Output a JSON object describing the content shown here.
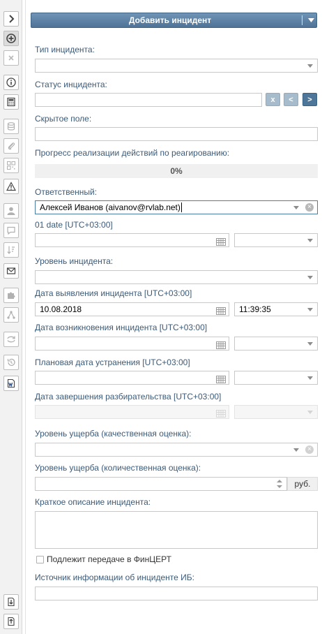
{
  "toolbar": {
    "icons": [
      "chevron-right-icon",
      "add-circle-icon",
      "close-icon",
      "info-icon",
      "calculator-icon",
      "database-icon",
      "paperclip-icon",
      "qr-code-icon",
      "warning-icon",
      "user-icon",
      "chat-icon",
      "sort-icon",
      "envelope-icon",
      "puzzle-icon",
      "network-icon",
      "sync-icon",
      "history-icon",
      "word-document-icon",
      "import-icon",
      "export-icon"
    ]
  },
  "form": {
    "add_button_label": "Добавить инцидент",
    "incident_type": {
      "label": "Тип инцидента:",
      "value": ""
    },
    "incident_status": {
      "label": "Статус инцидента:",
      "value": "",
      "btn_clear": "x",
      "btn_prev": "<",
      "btn_next": ">"
    },
    "hidden_field": {
      "label": "Скрытое поле:",
      "value": ""
    },
    "progress": {
      "label": "Прогресс реализации действий по реагированию:",
      "value_text": "0%",
      "value": 0
    },
    "responsible": {
      "label": "Ответственный:",
      "value": "Алексей Иванов (aivanov@rvlab.net)"
    },
    "date01": {
      "label": "01 date [UTC+03:00]",
      "date": "",
      "time": ""
    },
    "incident_level": {
      "label": "Уровень инцидента:",
      "value": ""
    },
    "detection_date": {
      "label": "Дата выявления инцидента [UTC+03:00]",
      "date": "10.08.2018",
      "time": "11:39:35"
    },
    "occurrence_date": {
      "label": "Дата возникновения инцидента [UTC+03:00]",
      "date": "",
      "time": ""
    },
    "planned_fix_date": {
      "label": "Плановая дата устранения [UTC+03:00]",
      "date": "",
      "time": ""
    },
    "investigation_end_date": {
      "label": "Дата завершения разбирательства [UTC+03:00]",
      "date": "",
      "time": ""
    },
    "damage_quality": {
      "label": "Уровень ущерба (качественная оценка):",
      "value": ""
    },
    "damage_quantity": {
      "label": "Уровень ущерба (количественная оценка):",
      "value": "",
      "unit": "руб."
    },
    "short_description": {
      "label": "Краткое описание инцидента:",
      "value": ""
    },
    "fincert": {
      "label": "Подлежит передаче в ФинЦЕРТ",
      "checked": false
    },
    "info_source": {
      "label": "Источник информации об инциденте ИБ:",
      "value": ""
    }
  }
}
